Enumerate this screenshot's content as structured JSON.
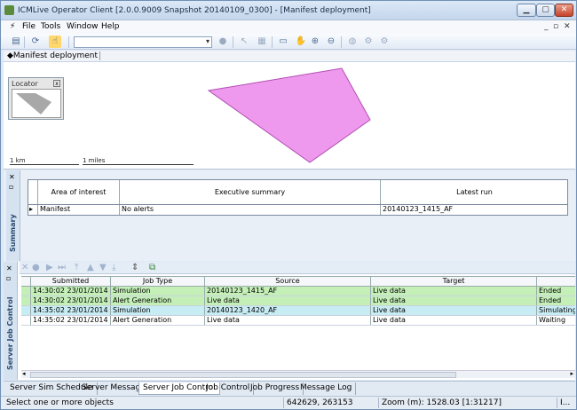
{
  "window": {
    "title": "ICMLive Operator Client [2.0.0.9009 Snapshot 20140109_0300] - [Manifest deployment]"
  },
  "menu": [
    {
      "label": "File"
    },
    {
      "label": "Tools"
    },
    {
      "label": "Window"
    },
    {
      "label": "Help"
    }
  ],
  "doc_tab": {
    "label": "Manifest deployment"
  },
  "map": {
    "locator_title": "Locator",
    "scale_km": "1 km",
    "scale_miles": "1 miles",
    "polygon_color": "#ee99ee"
  },
  "summary": {
    "side_label": "Summary",
    "columns": [
      "Area of interest",
      "Executive summary",
      "Latest run"
    ],
    "rows": [
      [
        "Manifest",
        "No alerts",
        "20140123_1415_AF"
      ]
    ]
  },
  "jobs": {
    "side_label": "Server Job Control",
    "columns": [
      "Submitted",
      "Job Type",
      "Source",
      "Target",
      ""
    ],
    "rows": [
      {
        "cells": [
          "14:30:02 23/01/2014",
          "Simulation",
          "20140123_1415_AF",
          "Live data",
          "Ended"
        ],
        "color": "green"
      },
      {
        "cells": [
          "14:30:02 23/01/2014",
          "Alert Generation",
          "Live data",
          "Live data",
          "Ended"
        ],
        "color": "green"
      },
      {
        "cells": [
          "14:35:02 23/01/2014",
          "Simulation",
          "20140123_1420_AF",
          "Live data",
          "Simulating ("
        ],
        "color": "blue"
      },
      {
        "cells": [
          "14:35:02 23/01/2014",
          "Alert Generation",
          "Live data",
          "Live data",
          "Waiting"
        ],
        "color": "white"
      }
    ]
  },
  "bottom_tabs": [
    {
      "label": "Server Sim Schedule"
    },
    {
      "label": "Server Messages"
    },
    {
      "label": "Server Job Control"
    },
    {
      "label": "Job Control"
    },
    {
      "label": "Job Progress"
    },
    {
      "label": "Message Log"
    }
  ],
  "status": {
    "message": "Select one or more objects",
    "coords": "642629, 263153",
    "zoom": "Zoom (m): 1528.03 [1:31217]",
    "extra": "I..."
  },
  "colors": {
    "green_row": "#c4f0b8",
    "blue_row": "#c8ecf4"
  }
}
